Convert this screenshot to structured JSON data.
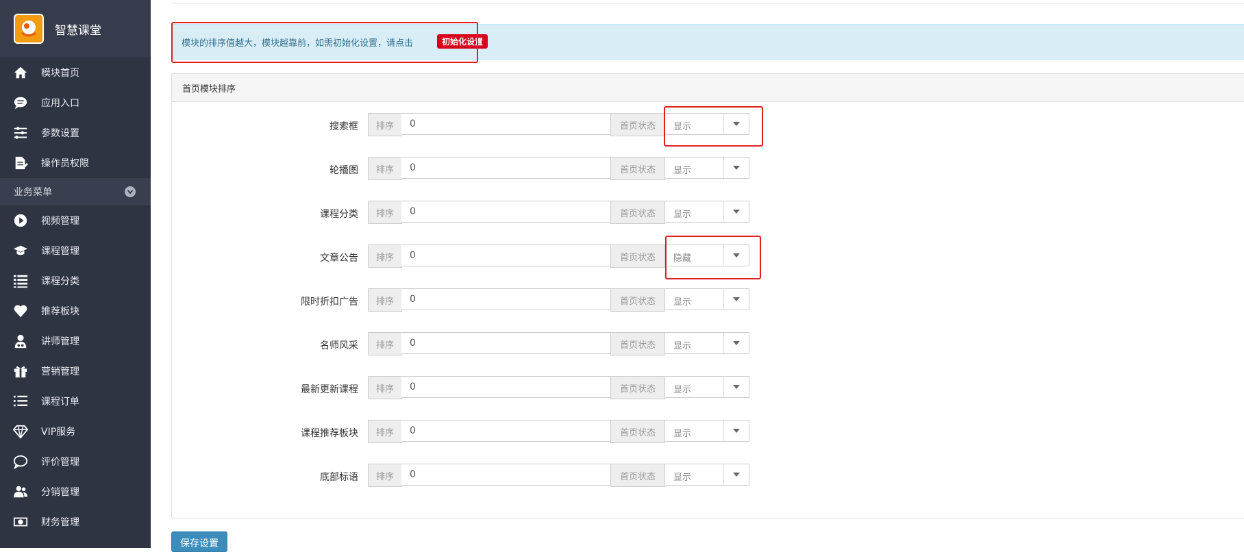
{
  "app": {
    "title": "智慧课堂"
  },
  "sidebar": {
    "top_items": [
      {
        "label": "模块首页",
        "icon": "home-icon"
      },
      {
        "label": "应用入口",
        "icon": "chat-icon"
      },
      {
        "label": "参数设置",
        "icon": "sliders-icon"
      },
      {
        "label": "操作员权限",
        "icon": "document-edit-icon"
      }
    ],
    "section_label": "业务菜单",
    "business_items": [
      {
        "label": "视频管理",
        "icon": "play-icon"
      },
      {
        "label": "课程管理",
        "icon": "graduation-cap-icon"
      },
      {
        "label": "课程分类",
        "icon": "list-icon"
      },
      {
        "label": "推荐板块",
        "icon": "heart-icon"
      },
      {
        "label": "讲师管理",
        "icon": "user-md-icon"
      },
      {
        "label": "营销管理",
        "icon": "gift-icon"
      },
      {
        "label": "课程订单",
        "icon": "ordered-list-icon"
      },
      {
        "label": "VIP服务",
        "icon": "diamond-icon"
      },
      {
        "label": "评价管理",
        "icon": "comment-icon"
      },
      {
        "label": "分销管理",
        "icon": "users-icon"
      },
      {
        "label": "财务管理",
        "icon": "money-icon"
      }
    ]
  },
  "notice": {
    "text": "模块的排序值越大，模块越靠前，如需初始化设置，请点击",
    "button_label": "初始化设置"
  },
  "panel": {
    "title": "首页模块排序",
    "sort_addon": "排序",
    "status_addon": "首页状态",
    "rows": [
      {
        "label": "搜索框",
        "sort": "0",
        "status": "显示"
      },
      {
        "label": "轮播图",
        "sort": "0",
        "status": "显示"
      },
      {
        "label": "课程分类",
        "sort": "0",
        "status": "显示"
      },
      {
        "label": "文章公告",
        "sort": "0",
        "status": "隐藏"
      },
      {
        "label": "限时折扣广告",
        "sort": "0",
        "status": "显示"
      },
      {
        "label": "名师风采",
        "sort": "0",
        "status": "显示"
      },
      {
        "label": "最新更新课程",
        "sort": "0",
        "status": "显示"
      },
      {
        "label": "课程推荐板块",
        "sort": "0",
        "status": "显示"
      },
      {
        "label": "底部标语",
        "sort": "0",
        "status": "显示"
      }
    ]
  },
  "save_button": {
    "label": "保存设置"
  },
  "colors": {
    "sidebar_bg": "#2f3443",
    "notice_bg": "#d9edf7",
    "badge_red": "#d9001b",
    "highlight_red": "#e02020",
    "primary_blue": "#3c8dbc"
  }
}
